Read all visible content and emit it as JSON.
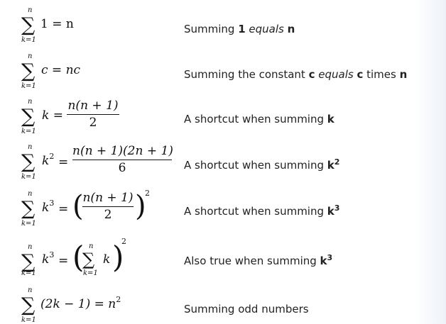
{
  "rows": [
    {
      "upper": "n",
      "lower": "k=1",
      "rhs": "1 = n",
      "desc": {
        "pre": "Summing ",
        "b1": "1",
        "mid": " equals ",
        "b2": "n",
        "post": ""
      }
    },
    {
      "upper": "n",
      "lower": "k=1",
      "rhs": "c = nc",
      "desc": {
        "pre": "Summing the constant ",
        "b1": "c",
        "mid": " equals ",
        "b2": "c",
        "post": " times ",
        "b3": "n"
      }
    },
    {
      "upper": "n",
      "lower": "k=1",
      "lhs": "k =",
      "num": "n(n + 1)",
      "den": "2",
      "desc": {
        "pre": "A shortcut when summing ",
        "b1": "k"
      }
    },
    {
      "upper": "n",
      "lower": "k=1",
      "lhs": "k",
      "lhs_sup": "2",
      "eq": "=",
      "num": "n(n + 1)(2n + 1)",
      "den": "6",
      "desc": {
        "pre": "A shortcut when summing ",
        "b1": "k",
        "sup": "2"
      }
    },
    {
      "upper": "n",
      "lower": "k=1",
      "lhs": "k",
      "lhs_sup": "3",
      "eq": "=",
      "num": "n(n + 1)",
      "den": "2",
      "outer_sup": "2",
      "desc": {
        "pre": "A shortcut when summing ",
        "b1": "k",
        "sup": "3"
      }
    },
    {
      "upper": "n",
      "lower": "k=1",
      "lhs": "k",
      "lhs_sup": "3",
      "eq": "=",
      "inner": "k",
      "outer_sup": "2",
      "desc": {
        "pre": "Also true when summing ",
        "b1": "k",
        "sup": "3"
      }
    },
    {
      "upper": "n",
      "lower": "k=1",
      "rhs": "(2k − 1) = n",
      "rhs_sup": "2",
      "desc": {
        "pre": "Summing odd numbers"
      }
    }
  ]
}
